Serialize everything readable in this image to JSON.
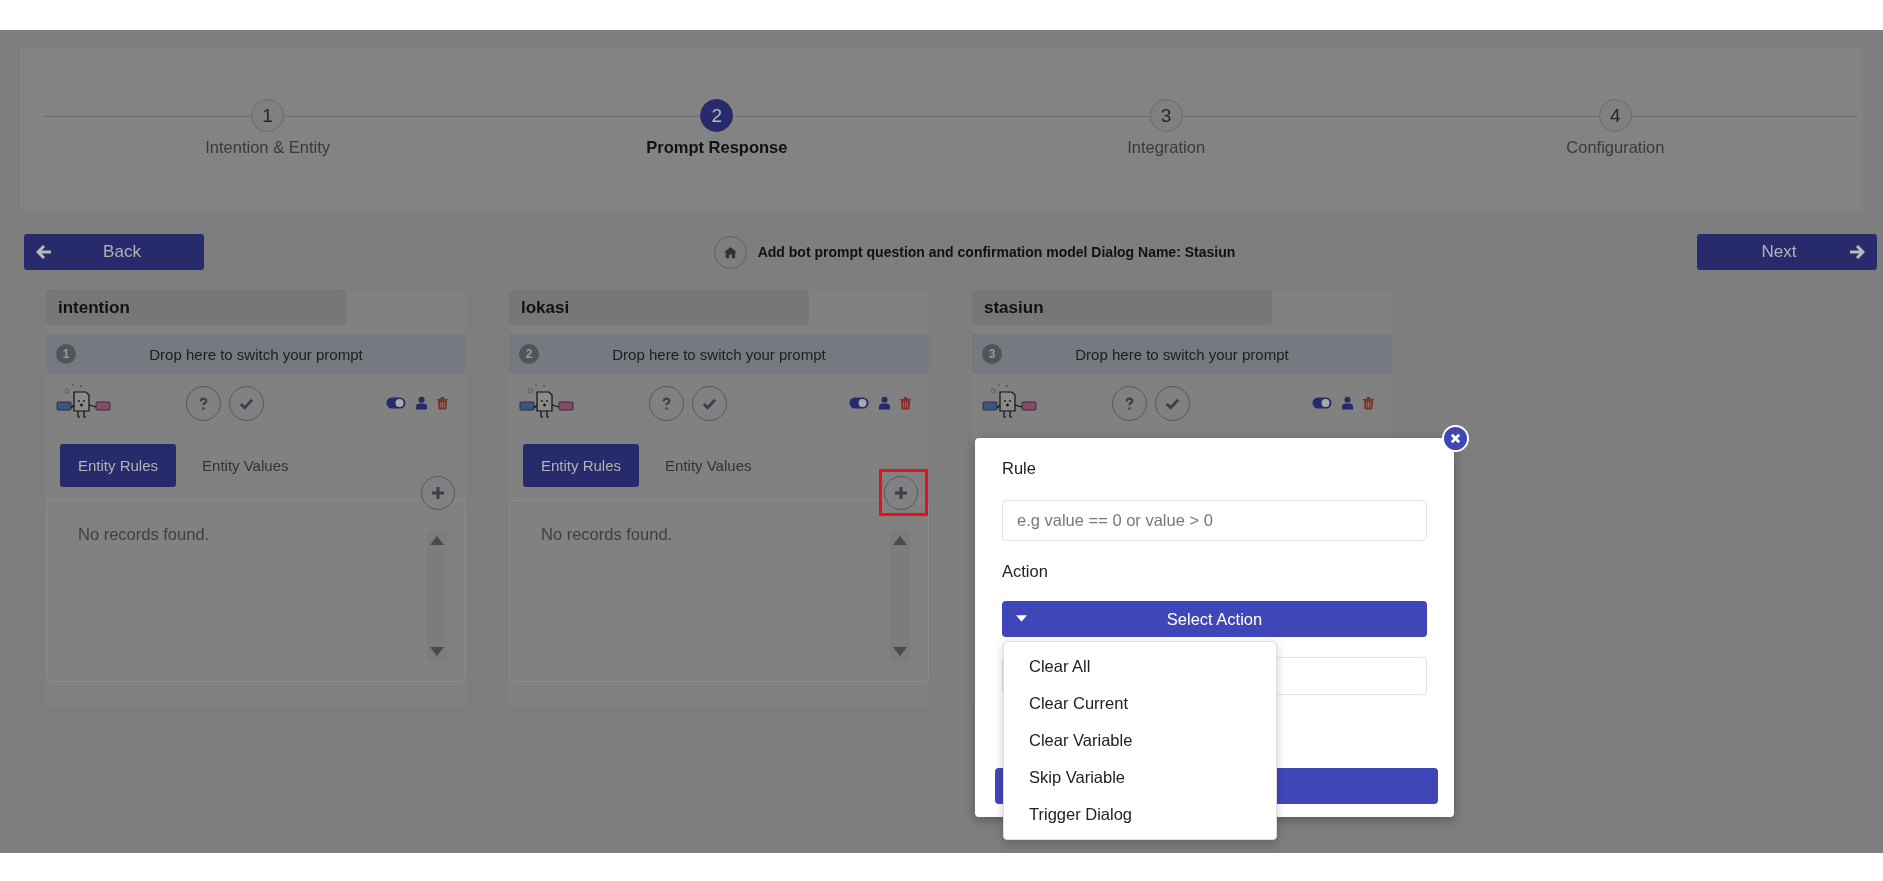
{
  "stepper": {
    "steps": [
      {
        "number": "1",
        "label": "Intention & Entity",
        "selected": false
      },
      {
        "number": "2",
        "label": "Prompt Response",
        "selected": true
      },
      {
        "number": "3",
        "label": "Integration",
        "selected": false
      },
      {
        "number": "4",
        "label": "Configuration",
        "selected": false
      }
    ]
  },
  "toolbar": {
    "back": "Back",
    "heading": "Add bot prompt question and confirmation model Dialog Name: Stasiun",
    "next": "Next"
  },
  "cards": [
    {
      "title": "intention",
      "number": "1",
      "drop_hint": "Drop here to switch your prompt",
      "enabled": true,
      "tabs": [
        {
          "label": "Entity Rules",
          "selected": true
        },
        {
          "label": "Entity Values",
          "selected": false
        }
      ],
      "empty_text": "No records found.",
      "add_highlighted": false
    },
    {
      "title": "lokasi",
      "number": "2",
      "drop_hint": "Drop here to switch your prompt",
      "enabled": true,
      "tabs": [
        {
          "label": "Entity Rules",
          "selected": true
        },
        {
          "label": "Entity Values",
          "selected": false
        }
      ],
      "empty_text": "No records found.",
      "add_highlighted": true
    },
    {
      "title": "stasiun",
      "number": "3",
      "drop_hint": "Drop here to switch your prompt",
      "enabled": true
    }
  ],
  "modal": {
    "rule_label": "Rule",
    "rule_placeholder": "e.g value == 0 or value > 0",
    "action_label": "Action",
    "select": {
      "label": "Select Action",
      "expanded": true,
      "options": [
        {
          "label": "Clear All",
          "selected": false
        },
        {
          "label": "Clear Current",
          "selected": false
        },
        {
          "label": "Clear Variable",
          "selected": false
        },
        {
          "label": "Skip Variable",
          "selected": false
        },
        {
          "label": "Trigger Dialog",
          "selected": false
        }
      ]
    }
  }
}
